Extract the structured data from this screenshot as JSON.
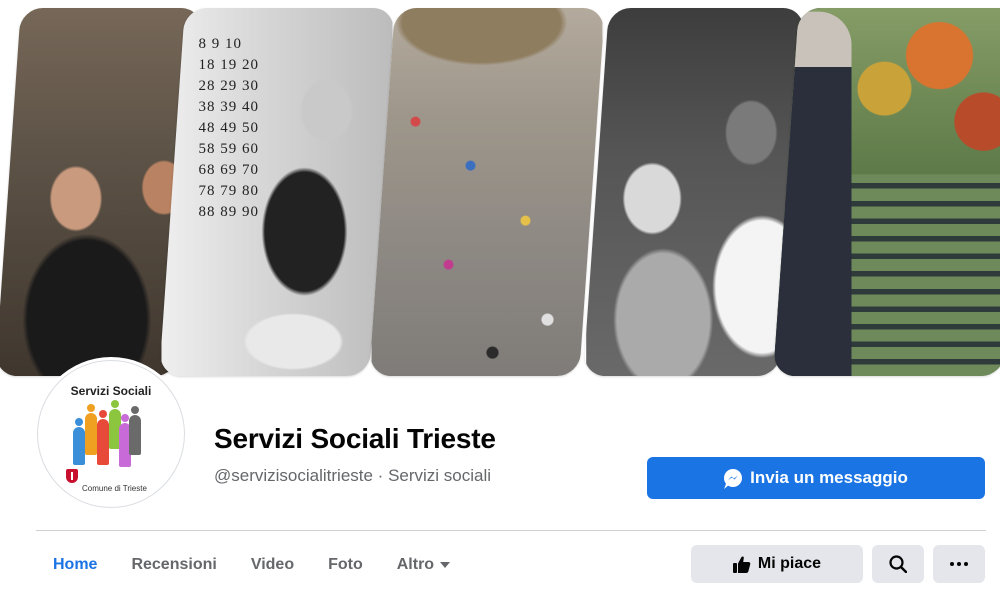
{
  "cover": {
    "panels": [
      {
        "id": "theatre-group"
      },
      {
        "id": "bingo-games"
      },
      {
        "id": "square-festival"
      },
      {
        "id": "elderly-care"
      },
      {
        "id": "chess-park"
      }
    ],
    "bingo_numbers": [
      "8 9 10",
      "18 19 20",
      "28 29 30",
      "38 39 40",
      "48 49 50",
      "58 59 60",
      "68 69 70",
      "78 79 80",
      "88 89 90"
    ]
  },
  "profile": {
    "avatar_title": "Servizi Sociali",
    "avatar_footer": "Comune di Trieste",
    "name": "Servizi Sociali Trieste",
    "handle": "@servizisocialitrieste · Servizi sociali"
  },
  "actions": {
    "message_label": "Invia un messaggio",
    "like_label": "Mi piace"
  },
  "tabs": [
    {
      "label": "Home",
      "active": true
    },
    {
      "label": "Recensioni"
    },
    {
      "label": "Video"
    },
    {
      "label": "Foto"
    },
    {
      "label": "Altro"
    }
  ],
  "colors": {
    "accent": "#1b74e4",
    "button_gray": "#e4e6eb",
    "secondary_text": "#65676b"
  },
  "icons": {
    "message": "messenger-icon",
    "like": "thumbs-up-icon",
    "search": "search-icon",
    "more": "more-dots-icon",
    "dropdown": "caret-down-icon"
  }
}
